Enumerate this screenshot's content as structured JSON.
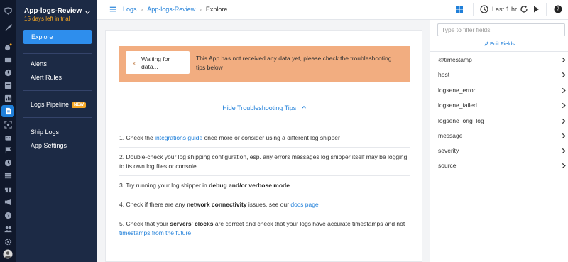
{
  "app": {
    "name": "App-logs-Review",
    "trial": "15 days left in trial"
  },
  "menu": {
    "explore": "Explore",
    "alerts": "Alerts",
    "alert_rules": "Alert Rules",
    "logs_pipeline": "Logs Pipeline",
    "new_badge": "NEW",
    "ship_logs": "Ship Logs",
    "app_settings": "App Settings"
  },
  "breadcrumb": {
    "logs": "Logs",
    "app": "App-logs-Review",
    "current": "Explore"
  },
  "toolbar": {
    "time_range": "Last 1 hr"
  },
  "banner": {
    "waiting": "Waiting for data...",
    "message": "This App has not received any data yet, please check the troubleshooting tips below"
  },
  "tips": {
    "toggle_label": "Hide Troubleshooting Tips",
    "t1_a": "1. Check the ",
    "t1_link": "integrations guide",
    "t1_b": " once more or consider using a different log shipper",
    "t2": "2. Double-check your log shipping configuration, esp. any errors messages log shipper itself may be logging to its own log files or console",
    "t3_a": "3. Try running your log shipper in ",
    "t3_bold": "debug and/or verbose mode",
    "t4_a": "4. Check if there are any ",
    "t4_bold": "network connectivity",
    "t4_b": " issues, see our ",
    "t4_link": "docs page",
    "t5_a": "5. Check that your ",
    "t5_bold1": "servers' clocks",
    "t5_b": " are correct and check that your logs have accurate timestamps and not ",
    "t5_link": "timestamps from the future"
  },
  "fields_panel": {
    "filter_placeholder": "Type to filter fields",
    "edit_fields": "Edit Fields",
    "fields": [
      "@timestamp",
      "host",
      "logsene_error",
      "logsene_failed",
      "logsene_orig_log",
      "message",
      "severity",
      "source"
    ]
  },
  "colors": {
    "rail_bg": "#10182b",
    "menu_bg": "#1c2a45",
    "accent": "#2e8eed",
    "link": "#1f7fd9",
    "banner_bg": "#f2ad80",
    "trial": "#f5a623"
  },
  "icons": {
    "rail": [
      "rocket-icon",
      "monitoring-icon",
      "alert-icon",
      "inbox-icon",
      "apps-icon",
      "logs-icon",
      "scan-icon",
      "bot-icon",
      "flag-icon",
      "clock-icon",
      "integrations-icon",
      "gift-icon",
      "announcement-icon",
      "help-icon",
      "team-icon",
      "settings-icon",
      "user-avatar"
    ],
    "topbar": [
      "dashboard-icon",
      "clock-icon",
      "refresh-icon",
      "play-icon",
      "help-icon"
    ]
  }
}
